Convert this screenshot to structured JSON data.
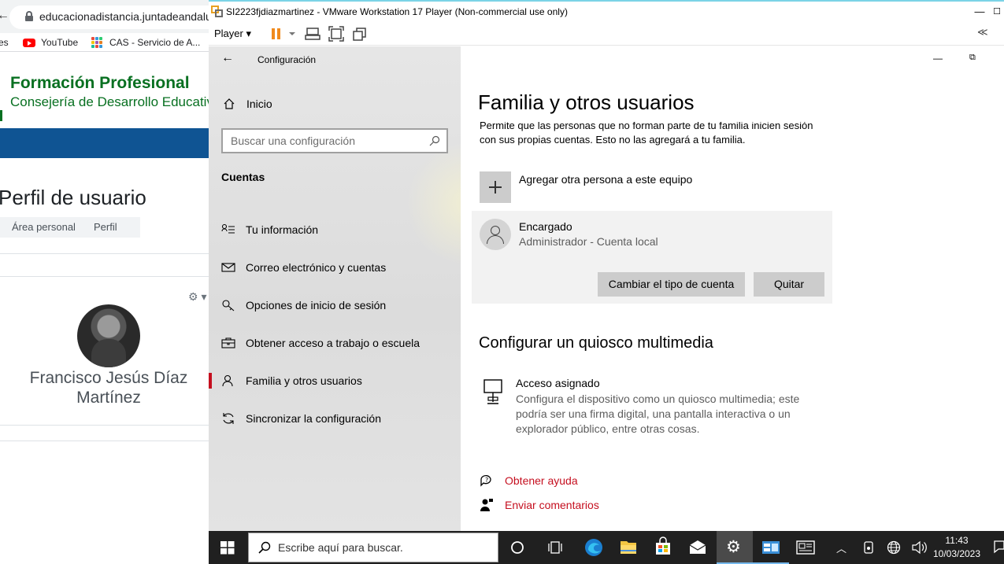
{
  "browser": {
    "url": "educacionadistancia.juntadeandalucia.es",
    "bookmarks": [
      {
        "label": "es"
      },
      {
        "label": "YouTube"
      },
      {
        "label": "CAS - Servicio de A..."
      }
    ],
    "site_title": "Formación Profesional",
    "site_subtitle": "Consejería de Desarrollo Educativo",
    "page_title": "Perfil de usuario",
    "breadcrumb": [
      "Área personal",
      "Perfil"
    ],
    "user_name": "Francisco Jesús Díaz Martínez"
  },
  "vmware": {
    "window_title": "SI2223fjdiazmartinez - VMware Workstation 17 Player (Non-commercial use only)",
    "player_menu": "Player",
    "collapse_label": "≪"
  },
  "settings": {
    "app_title": "Configuración",
    "home_label": "Inicio",
    "search_placeholder": "Buscar una configuración",
    "section_title": "Cuentas",
    "nav_items": [
      {
        "label": "Tu información",
        "icon": "user-card-icon"
      },
      {
        "label": "Correo electrónico y cuentas",
        "icon": "mail-icon"
      },
      {
        "label": "Opciones de inicio de sesión",
        "icon": "key-icon"
      },
      {
        "label": "Obtener acceso a trabajo o escuela",
        "icon": "briefcase-icon"
      },
      {
        "label": "Familia y otros usuarios",
        "icon": "person-icon",
        "active": true
      },
      {
        "label": "Sincronizar la configuración",
        "icon": "sync-icon"
      }
    ],
    "page_title": "Familia y otros usuarios",
    "description": "Permite que las personas que no forman parte de tu familia inicien sesión con sus propias cuentas. Esto no las agregará a tu familia.",
    "add_person_label": "Agregar otra persona a este equipo",
    "account": {
      "name": "Encargado",
      "type": "Administrador - Cuenta local",
      "change_type_button": "Cambiar el tipo de cuenta",
      "remove_button": "Quitar"
    },
    "kiosk_section_title": "Configurar un quiosco multimedia",
    "kiosk_title": "Acceso asignado",
    "kiosk_description": "Configura el dispositivo como un quiosco multimedia; este podría ser una firma digital, una pantalla interactiva o un explorador público, entre otras cosas.",
    "help_link": "Obtener ayuda",
    "feedback_link": "Enviar comentarios"
  },
  "taskbar": {
    "search_placeholder": "Escribe aquí para buscar.",
    "time": "11:43",
    "date": "10/03/2023"
  },
  "colors": {
    "accent": "#c50f1f",
    "taskbar": "#202020",
    "moodle_blue": "#0f5493",
    "fp_green": "#087021"
  }
}
